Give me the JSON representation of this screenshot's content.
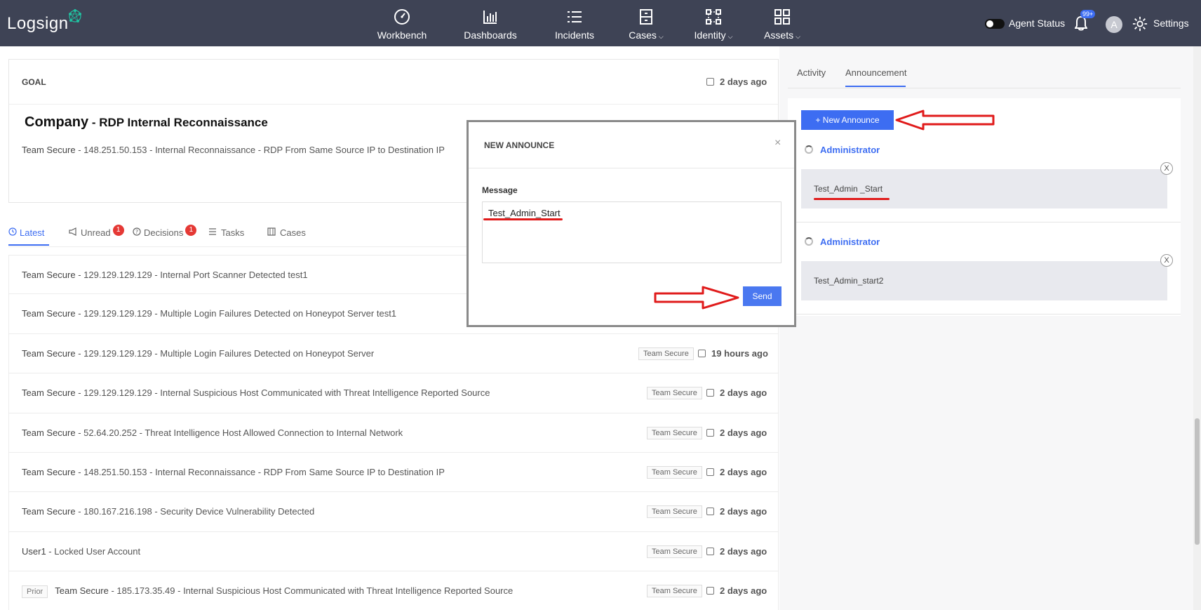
{
  "nav": {
    "logo": "Logsign",
    "items": [
      {
        "label": "Workbench",
        "chevron": ""
      },
      {
        "label": "Dashboards",
        "chevron": ""
      },
      {
        "label": "Incidents",
        "chevron": ""
      },
      {
        "label": "Cases",
        "chevron": "⌵"
      },
      {
        "label": "Identity",
        "chevron": "⌵"
      },
      {
        "label": "Assets",
        "chevron": "⌵"
      }
    ],
    "agent_status": "Agent Status",
    "notification_count": "99+",
    "avatar_initial": "A",
    "settings": "Settings"
  },
  "goal": {
    "label": "GOAL",
    "date": "2 days ago",
    "title_company": "Company",
    "title_sep": " - ",
    "title_rest": "RDP Internal Reconnaissance",
    "desc_source": "Team Secure",
    "desc_rest": " - 148.251.50.153 - Internal Reconnaissance - RDP From Same Source IP to Destination IP"
  },
  "tabs": [
    {
      "label": "Latest",
      "badge": ""
    },
    {
      "label": "Unread",
      "badge": "1"
    },
    {
      "label": "Decisions",
      "badge": "1"
    },
    {
      "label": "Tasks",
      "badge": ""
    },
    {
      "label": "Cases",
      "badge": ""
    }
  ],
  "feed": [
    {
      "prior": "",
      "source": "Team Secure",
      "text": " - 129.129.129.129 - Internal Port Scanner Detected test1",
      "tag": "",
      "date": ""
    },
    {
      "prior": "",
      "source": "Team Secure",
      "text": " - 129.129.129.129 - Multiple Login Failures Detected on Honeypot Server test1",
      "tag": "",
      "date": ""
    },
    {
      "prior": "",
      "source": "Team Secure",
      "text": " - 129.129.129.129 - Multiple Login Failures Detected on Honeypot Server",
      "tag": "Team Secure",
      "date": "19 hours ago"
    },
    {
      "prior": "",
      "source": "Team Secure",
      "text": " - 129.129.129.129 - Internal Suspicious Host Communicated with Threat Intelligence Reported Source",
      "tag": "Team Secure",
      "date": "2 days ago"
    },
    {
      "prior": "",
      "source": "Team Secure",
      "text": " - 52.64.20.252 - Threat Intelligence Host Allowed Connection to Internal Network",
      "tag": "Team Secure",
      "date": "2 days ago"
    },
    {
      "prior": "",
      "source": "Team Secure",
      "text": " - 148.251.50.153 - Internal Reconnaissance - RDP From Same Source IP to Destination IP",
      "tag": "Team Secure",
      "date": "2 days ago"
    },
    {
      "prior": "",
      "source": "Team Secure",
      "text": " - 180.167.216.198 - Security Device Vulnerability Detected",
      "tag": "Team Secure",
      "date": "2 days ago"
    },
    {
      "prior": "",
      "source": "User1",
      "text": " - Locked User Account",
      "tag": "Team Secure",
      "date": "2 days ago"
    },
    {
      "prior": "Prior",
      "source": "Team Secure",
      "text": "  - 185.173.35.49 - Internal Suspicious Host Communicated with Threat Intelligence Reported Source",
      "tag": "Team Secure",
      "date": "2 days ago"
    }
  ],
  "right_panel": {
    "tabs": [
      "Activity",
      "Announcement"
    ],
    "new_button": "+ New Announce",
    "announcements": [
      {
        "author": "Administrator",
        "message": "Test_Admin _Start"
      },
      {
        "author": "Administrator",
        "message": "Test_Admin_start2"
      }
    ],
    "close_glyph": "X"
  },
  "modal": {
    "title": "NEW ANNOUNCE",
    "close": "×",
    "message_label": "Message",
    "message_value": "Test_Admin_Start",
    "send": "Send"
  },
  "colors": {
    "nav_bg": "#3e4355",
    "accent": "#3d6df2",
    "badge": "#e53935",
    "annotation": "#e01b1b"
  }
}
